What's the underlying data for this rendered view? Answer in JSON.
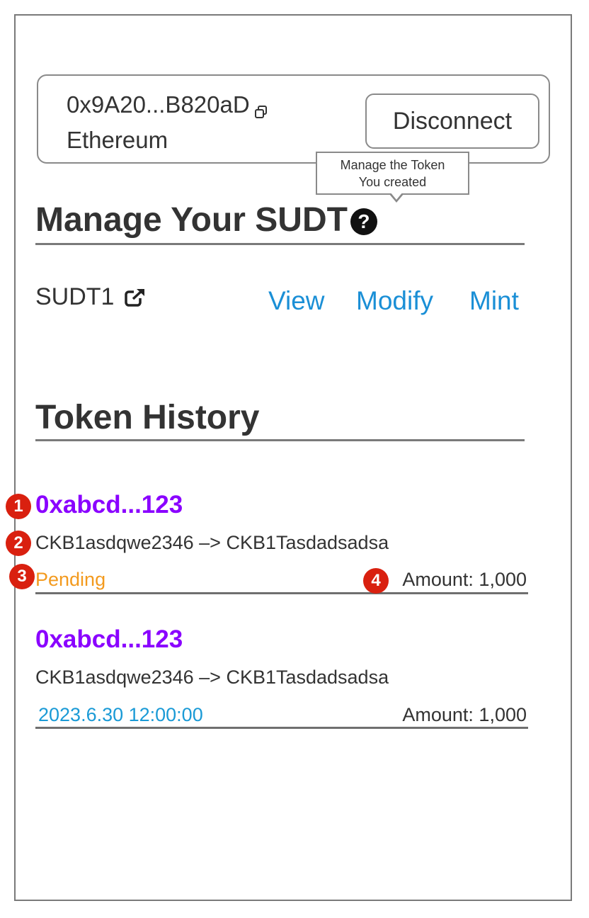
{
  "wallet": {
    "address": "0x9A20...B820aD",
    "network": "Ethereum",
    "disconnect_label": "Disconnect"
  },
  "tooltip": {
    "line1": "Manage the Token",
    "line2": "You created"
  },
  "manage_section": {
    "title": "Manage Your SUDT",
    "help_glyph": "?"
  },
  "tokens": [
    {
      "name": "SUDT1",
      "actions": [
        "View",
        "Modify",
        "Mint"
      ]
    }
  ],
  "history_section": {
    "title": "Token History"
  },
  "transactions": [
    {
      "hash": "0xabcd...123",
      "route": "CKB1asdqwe2346 –> CKB1Tasdadsadsa",
      "status": "Pending",
      "amount": "Amount: 1,000"
    },
    {
      "hash": "0xabcd...123",
      "route": "CKB1asdqwe2346 –> CKB1Tasdadsadsa",
      "timestamp": "2023.6.30 12:00:00",
      "amount": "Amount: 1,000"
    }
  ],
  "annotations": [
    "1",
    "2",
    "3",
    "4"
  ],
  "colors": {
    "link": "#1a8fd6",
    "hash": "#8a00ff",
    "pending": "#f39a1e",
    "timestamp": "#1a9ad6",
    "badge": "#d9200f"
  }
}
